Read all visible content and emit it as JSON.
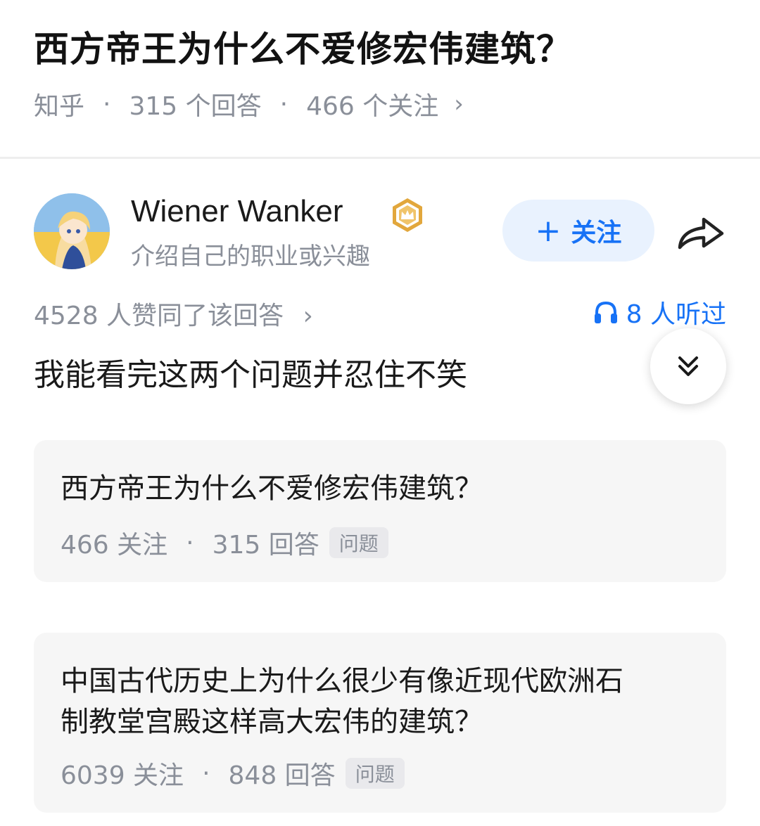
{
  "question": {
    "title": "西方帝王为什么不爱修宏伟建筑？",
    "source": "知乎",
    "answers": "315 个回答",
    "followers": "466 个关注",
    "separator": "·",
    "chevron": "›"
  },
  "author": {
    "name": "Wiener Wanker",
    "bio": "介绍自己的职业或兴趣",
    "badge_icon": "crown-badge-icon",
    "follow_plus": "+",
    "follow_label": "关注"
  },
  "answer": {
    "votes": "4528 人赞同了该回答",
    "listened": "8 人听过",
    "text": "我能看完这两个问题并忍住不笑"
  },
  "cards": [
    {
      "title": "西方帝王为什么不爱修宏伟建筑？",
      "followers": "466 关注",
      "answers": "315 回答",
      "tag": "问题"
    },
    {
      "title_line1": "中国古代历史上为什么很少有像近现代欧洲石",
      "title_line2": "制教堂宫殿这样高大宏伟的建筑？",
      "followers": "6039 关注",
      "answers": "848 回答",
      "tag": "问题"
    }
  ],
  "colors": {
    "accent": "#1772f6",
    "muted": "#8a8f99",
    "badge": "#e2a73c"
  }
}
